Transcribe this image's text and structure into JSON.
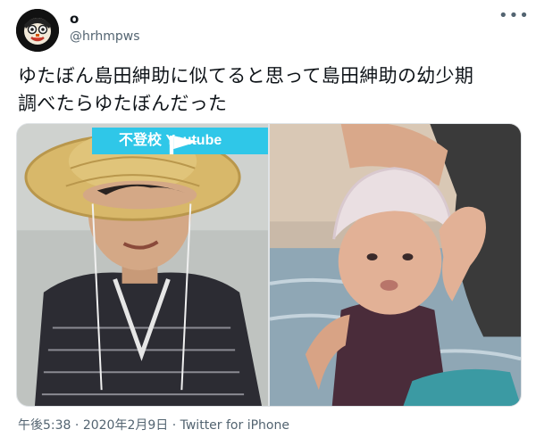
{
  "author": {
    "display_name": "o",
    "handle": "@hrhmpws"
  },
  "tweet": {
    "text_line1": "ゆたぼん島田紳助に似てると思って島田紳助の幼少期",
    "text_line2": "調べたらゆたぼんだった"
  },
  "media": {
    "left_caption": "不登校 Youtube"
  },
  "meta": {
    "time": "午後5:38",
    "separator": " · ",
    "date": "2020年2月9日",
    "source": "Twitter for iPhone"
  },
  "icons": {
    "more": "more-horizontal-icon",
    "avatar": "avatar-cartoon-face",
    "flag": "flag-icon"
  },
  "colors": {
    "text_primary": "#0f1419",
    "text_secondary": "#536471",
    "caption_banner": "#2fc7e8",
    "border": "#dfe3e6"
  }
}
